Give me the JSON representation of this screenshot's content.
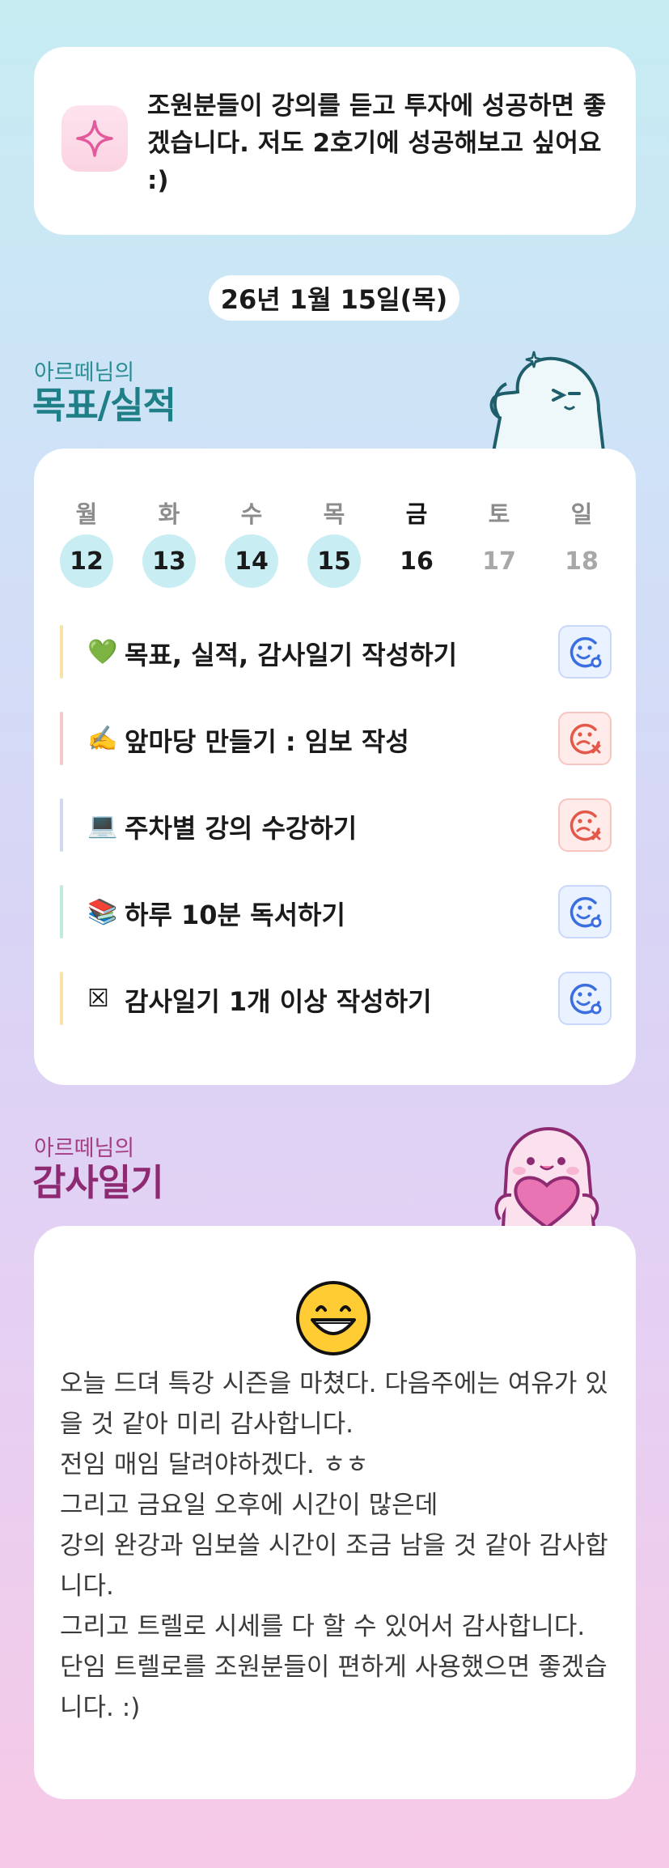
{
  "message": {
    "icon": "sparkle-icon",
    "text": "조원분들이 강의를 듣고 투자에 성공하면 좋겠습니다. 저도 2호기에 성공해보고 싶어요 :)"
  },
  "date_label": "26년 1월 15일(목)",
  "goals_section": {
    "owner": "아르떼님의",
    "title": "목표/실적"
  },
  "week": [
    {
      "name": "월",
      "num": "12",
      "state": "done"
    },
    {
      "name": "화",
      "num": "13",
      "state": "done"
    },
    {
      "name": "수",
      "num": "14",
      "state": "done"
    },
    {
      "name": "목",
      "num": "15",
      "state": "done"
    },
    {
      "name": "금",
      "num": "16",
      "state": "today"
    },
    {
      "name": "토",
      "num": "17",
      "state": "future"
    },
    {
      "name": "일",
      "num": "18",
      "state": "future"
    }
  ],
  "tasks": [
    {
      "emoji": "💚",
      "label": "목표, 실적, 감사일기 작성하기",
      "status": "done",
      "bar_color": "#f7e3a8"
    },
    {
      "emoji": "✍️",
      "label": "앞마당 만들기 : 임보 작성",
      "status": "not-done",
      "bar_color": "#f7c8c8"
    },
    {
      "emoji": "💻",
      "label": "주차별 강의 수강하기",
      "status": "not-done",
      "bar_color": "#cfd9f2"
    },
    {
      "emoji": "📚",
      "label": "하루 10분 독서하기",
      "status": "done",
      "bar_color": "#bfeadf"
    },
    {
      "emoji": "☒",
      "label": "감사일기 1개 이상 작성하기",
      "status": "done",
      "bar_color": "#f7e3a8"
    }
  ],
  "gratitude_section": {
    "owner": "아르떼님의",
    "title": "감사일기"
  },
  "gratitude": {
    "emoji_icon": "grinning-face-icon",
    "text": "오늘 드뎌 특강 시즌을 마쳤다. 다음주에는 여유가 있을 것 같아 미리 감사합니다.\n전임 매임 달려야하겠다. ㅎㅎ\n그리고 금요일 오후에 시간이 많은데\n강의 완강과 임보쓸 시간이 조금 남을 것 같아 감사합니다.\n그리고 트렐로 시세를 다 할 수 있어서 감사합니다.\n단임 트렐로를 조원분들이 편하게 사용했으면 좋겠습니다. :)"
  },
  "colors": {
    "goal_title": "#1f7f86",
    "gratitude_title": "#8d2a72",
    "done_circle": "#c8eef3",
    "status_ok": "#3b6fe0",
    "status_no": "#e4584a"
  }
}
